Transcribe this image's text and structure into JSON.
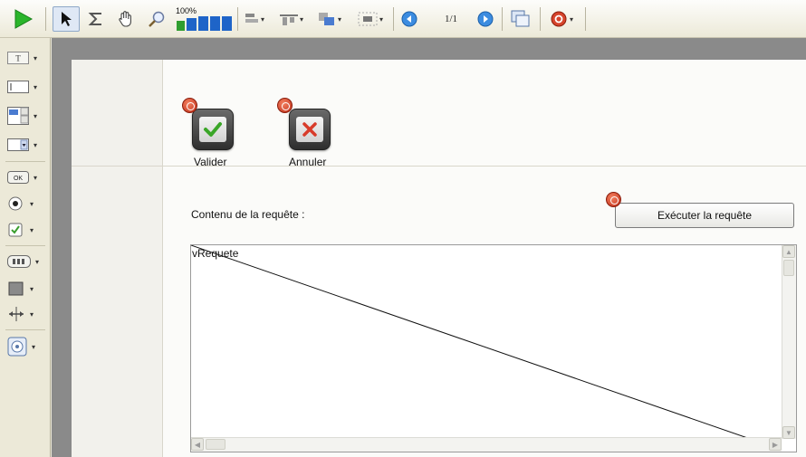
{
  "toolbar": {
    "zoom": "100%",
    "page_indicator": "1/1",
    "icons": [
      "run-icon",
      "select-arrow-icon",
      "sigma-icon",
      "hand-pan-icon",
      "zoom-icon",
      "zoom-level-icon",
      "align-icon",
      "distribute-icon",
      "layer-order-icon",
      "grid-icon",
      "previous-page-icon",
      "next-page-icon",
      "window-icon",
      "plan-icon"
    ]
  },
  "palette": {
    "icons": [
      "text-field-icon",
      "edit-field-icon",
      "spin-field-icon",
      "combo-box-icon",
      "button-icon",
      "radio-button-icon",
      "checkbox-icon",
      "table-icon",
      "shape-icon",
      "separator-icon",
      "supercontrol-icon"
    ]
  },
  "buttons": {
    "validate_label": "Valider",
    "cancel_label": "Annuler",
    "execute_label": "Exécuter la requête"
  },
  "form": {
    "request_label": "Contenu de la requête :",
    "memo_binding": "vRequete"
  },
  "colors": {
    "run": "#2bb52b",
    "validate_check": "#3aa628",
    "cancel_x": "#d83b2a",
    "badge": "#c2301a",
    "editor_background": "#8a8a8a"
  }
}
